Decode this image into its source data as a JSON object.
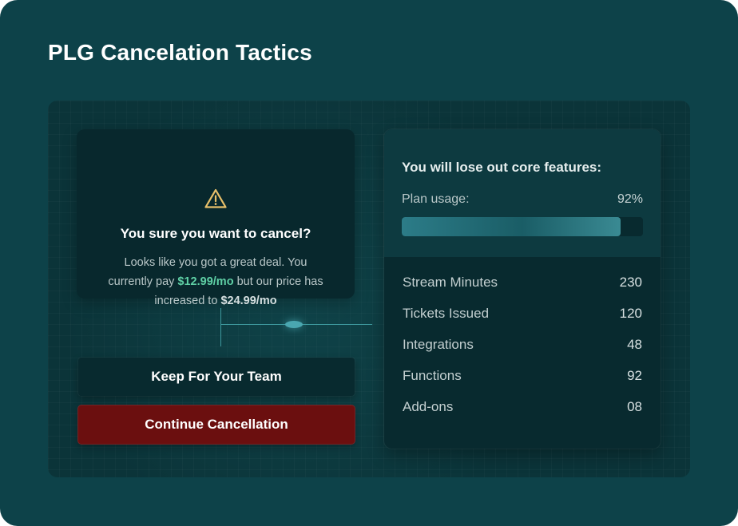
{
  "page": {
    "title": "PLG Cancelation Tactics"
  },
  "alert": {
    "icon": "warning-icon",
    "title": "You sure you want to cancel?",
    "body_start": "Looks like you got a great deal. You currently pay ",
    "current_price": "$12.99/mo",
    "body_middle": " but our price has increased to ",
    "new_price": "$24.99/mo"
  },
  "actions": {
    "keep_label": "Keep For Your Team",
    "cancel_label": "Continue Cancellation"
  },
  "features": {
    "title": "You will lose out core features:",
    "usage_label": "Plan usage:",
    "usage_value": "92%",
    "usage_fraction": 0.92,
    "items": [
      {
        "label": "Stream Minutes",
        "value": "230"
      },
      {
        "label": "Tickets Issued",
        "value": "120"
      },
      {
        "label": "Integrations",
        "value": "48"
      },
      {
        "label": "Functions",
        "value": "92"
      },
      {
        "label": "Add-ons",
        "value": "08"
      }
    ]
  },
  "colors": {
    "background": "#0d4249",
    "accent_price": "#5fd0a6",
    "cancel_button": "#6b0f0f",
    "warning": "#e8c06a"
  }
}
